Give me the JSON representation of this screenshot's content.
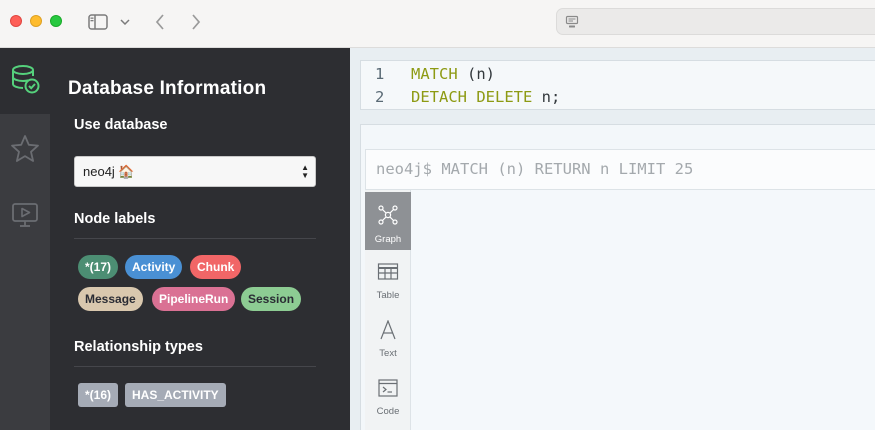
{
  "db_panel": {
    "title": "Database Information",
    "use_database": {
      "heading": "Use database",
      "selected": "neo4j 🏠"
    },
    "node_labels": {
      "heading": "Node labels",
      "items": [
        {
          "label": "*(17)",
          "color": "#4c8e73",
          "text_color": "#ffffff"
        },
        {
          "label": "Activity",
          "color": "#4a90d4",
          "text_color": "#ffffff"
        },
        {
          "label": "Chunk",
          "color": "#f16667",
          "text_color": "#ffffff"
        },
        {
          "label": "Message",
          "color": "#d9c8ae",
          "text_color": "#2a2c34"
        },
        {
          "label": "PipelineRun",
          "color": "#da7194",
          "text_color": "#ffffff"
        },
        {
          "label": "Session",
          "color": "#8dcc93",
          "text_color": "#2a2c34"
        }
      ]
    },
    "relationship_types": {
      "heading": "Relationship types",
      "items": [
        {
          "label": "*(16)"
        },
        {
          "label": "HAS_ACTIVITY"
        }
      ]
    }
  },
  "rail": {
    "items": [
      {
        "icon": "database-check-icon",
        "active": true
      },
      {
        "icon": "star-icon",
        "active": false
      },
      {
        "icon": "monitor-play-icon",
        "active": false
      }
    ]
  },
  "editor": {
    "lines": [
      {
        "number": "1",
        "keyword": "MATCH",
        "rest": " (n)"
      },
      {
        "number": "2",
        "keyword": "DETACH DELETE",
        "rest": " n;"
      }
    ]
  },
  "result": {
    "prompt": "neo4j$ MATCH (n) RETURN n LIMIT 25",
    "view_tabs": [
      {
        "label": "Graph",
        "icon": "graph-icon",
        "active": true
      },
      {
        "label": "Table",
        "icon": "table-icon",
        "active": false
      },
      {
        "label": "Text",
        "icon": "text-icon",
        "active": false
      },
      {
        "label": "Code",
        "icon": "code-icon",
        "active": false
      }
    ]
  }
}
